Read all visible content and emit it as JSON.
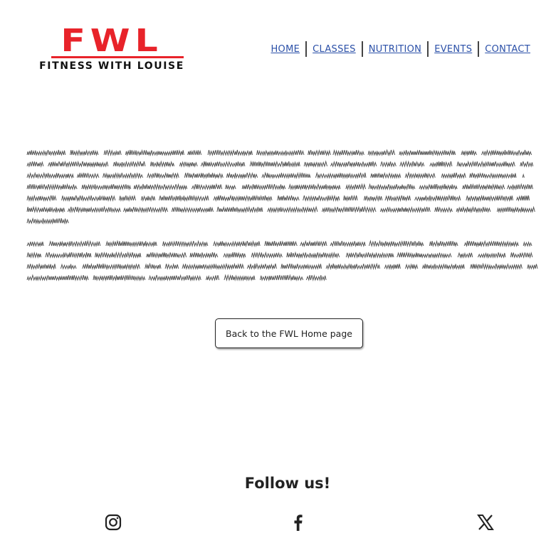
{
  "logo": {
    "mark": "FWL",
    "tagline": "FITNESS WITH LOUISE"
  },
  "nav": [
    {
      "label": "HOME"
    },
    {
      "label": "CLASSES"
    },
    {
      "label": "NUTRITION"
    },
    {
      "label": "EVENTS"
    },
    {
      "label": "CONTACT"
    }
  ],
  "back_button": {
    "label": "Back to the FWL Home page"
  },
  "follow": {
    "heading": "Follow us!"
  },
  "social": [
    {
      "icon": "instagram-icon"
    },
    {
      "icon": "facebook-icon"
    },
    {
      "icon": "x-icon"
    }
  ],
  "colors": {
    "brand_red": "#e8232a",
    "nav_link": "#2b50a8",
    "text": "#222222"
  }
}
